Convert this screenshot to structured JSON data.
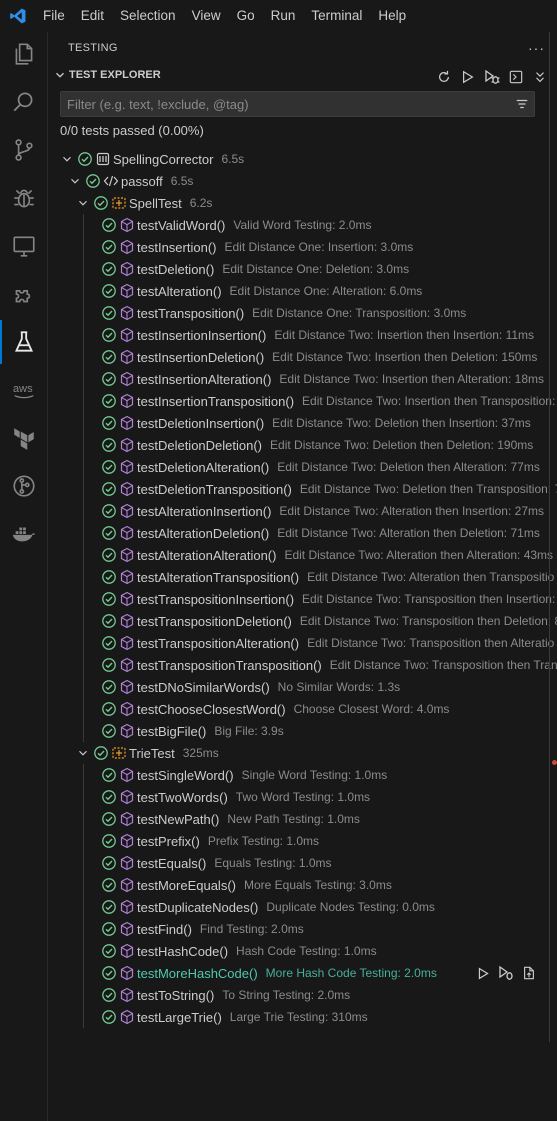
{
  "menu": [
    "File",
    "Edit",
    "Selection",
    "View",
    "Go",
    "Run",
    "Terminal",
    "Help"
  ],
  "activity": [
    "explorer-icon",
    "search-icon",
    "source-control-icon",
    "run-debug-icon",
    "remote-explorer-icon",
    "extensions-icon",
    "testing-icon",
    "aws-icon",
    "terraform-icon",
    "git-graph-icon",
    "docker-icon"
  ],
  "aws_label": "aws",
  "panel": {
    "title": "TESTING",
    "more": "···",
    "section": "TEST EXPLORER",
    "filter_placeholder": "Filter (e.g. text, !exclude, @tag)",
    "summary": "0/0 tests passed (0.00%)"
  },
  "colors": {
    "pass": "#73c991",
    "accent": "#0078d4",
    "method": "#b180d7",
    "class": "#ee9d28",
    "selected": "#4ec9b0"
  },
  "tree": {
    "root": {
      "name": "SpellingCorrector",
      "desc": "6.5s"
    },
    "pkg": {
      "name": "passoff",
      "desc": "6.5s"
    },
    "spell": {
      "name": "SpellTest",
      "desc": "6.2s"
    },
    "spell_tests": [
      {
        "name": "testValidWord()",
        "desc": "Valid Word Testing: 2.0ms"
      },
      {
        "name": "testInsertion()",
        "desc": "Edit Distance One: Insertion: 3.0ms"
      },
      {
        "name": "testDeletion()",
        "desc": "Edit Distance One: Deletion: 3.0ms"
      },
      {
        "name": "testAlteration()",
        "desc": "Edit Distance One: Alteration: 6.0ms"
      },
      {
        "name": "testTransposition()",
        "desc": "Edit Distance One: Transposition: 3.0ms"
      },
      {
        "name": "testInsertionInsertion()",
        "desc": "Edit Distance Two: Insertion then Insertion: 11ms"
      },
      {
        "name": "testInsertionDeletion()",
        "desc": "Edit Distance Two: Insertion then Deletion: 150ms"
      },
      {
        "name": "testInsertionAlteration()",
        "desc": "Edit Distance Two: Insertion then Alteration: 18ms"
      },
      {
        "name": "testInsertionTransposition()",
        "desc": "Edit Distance Two: Insertion then Transposition:"
      },
      {
        "name": "testDeletionInsertion()",
        "desc": "Edit Distance Two: Deletion then Insertion: 37ms"
      },
      {
        "name": "testDeletionDeletion()",
        "desc": "Edit Distance Two: Deletion then Deletion: 190ms"
      },
      {
        "name": "testDeletionAlteration()",
        "desc": "Edit Distance Two: Deletion then Alteration: 77ms"
      },
      {
        "name": "testDeletionTransposition()",
        "desc": "Edit Distance Two: Deletion then Transposition: 7"
      },
      {
        "name": "testAlterationInsertion()",
        "desc": "Edit Distance Two: Alteration then Insertion: 27ms"
      },
      {
        "name": "testAlterationDeletion()",
        "desc": "Edit Distance Two: Alteration then Deletion: 71ms"
      },
      {
        "name": "testAlterationAlteration()",
        "desc": "Edit Distance Two: Alteration then Alteration: 43ms"
      },
      {
        "name": "testAlterationTransposition()",
        "desc": "Edit Distance Two: Alteration then Transpositio"
      },
      {
        "name": "testTranspositionInsertion()",
        "desc": "Edit Distance Two: Transposition then Insertion:"
      },
      {
        "name": "testTranspositionDeletion()",
        "desc": "Edit Distance Two: Transposition then Deletion: 8"
      },
      {
        "name": "testTranspositionAlteration()",
        "desc": "Edit Distance Two: Transposition then Alteratio"
      },
      {
        "name": "testTranspositionTransposition()",
        "desc": "Edit Distance Two: Transposition then Trans"
      },
      {
        "name": "testDNoSimilarWords()",
        "desc": "No Similar Words: 1.3s"
      },
      {
        "name": "testChooseClosestWord()",
        "desc": "Choose Closest Word: 4.0ms"
      },
      {
        "name": "testBigFile()",
        "desc": "Big File: 3.9s"
      }
    ],
    "trie": {
      "name": "TrieTest",
      "desc": "325ms"
    },
    "trie_tests": [
      {
        "name": "testSingleWord()",
        "desc": "Single Word Testing: 1.0ms"
      },
      {
        "name": "testTwoWords()",
        "desc": "Two Word Testing: 1.0ms"
      },
      {
        "name": "testNewPath()",
        "desc": "New Path Testing: 1.0ms"
      },
      {
        "name": "testPrefix()",
        "desc": "Prefix Testing: 1.0ms"
      },
      {
        "name": "testEquals()",
        "desc": "Equals Testing: 1.0ms"
      },
      {
        "name": "testMoreEquals()",
        "desc": "More Equals Testing: 3.0ms"
      },
      {
        "name": "testDuplicateNodes()",
        "desc": "Duplicate Nodes Testing: 0.0ms"
      },
      {
        "name": "testFind()",
        "desc": "Find Testing: 2.0ms"
      },
      {
        "name": "testHashCode()",
        "desc": "Hash Code Testing: 1.0ms"
      },
      {
        "name": "testMoreHashCode()",
        "desc": "More Hash Code Testing: 2.0ms",
        "selected": true
      },
      {
        "name": "testToString()",
        "desc": "To String Testing: 2.0ms"
      },
      {
        "name": "testLargeTrie()",
        "desc": "Large Trie Testing: 310ms"
      }
    ]
  }
}
